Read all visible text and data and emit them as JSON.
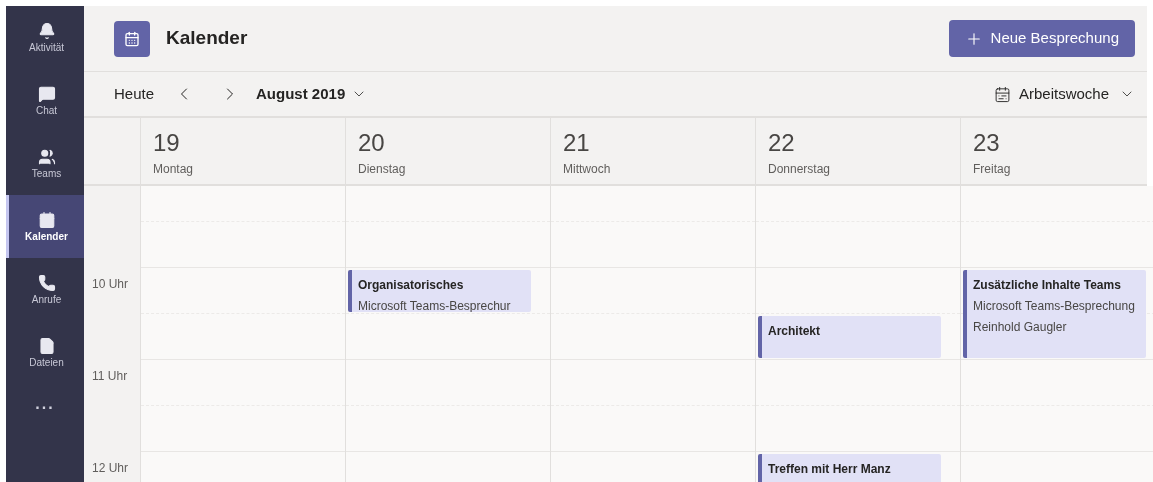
{
  "sidebar": {
    "items": [
      {
        "kind": "activity",
        "label": "Aktivität",
        "selected": false
      },
      {
        "kind": "chat",
        "label": "Chat",
        "selected": false
      },
      {
        "kind": "teams",
        "label": "Teams",
        "selected": false
      },
      {
        "kind": "calendar",
        "label": "Kalender",
        "selected": true
      },
      {
        "kind": "calls",
        "label": "Anrufe",
        "selected": false
      },
      {
        "kind": "files",
        "label": "Dateien",
        "selected": false
      }
    ],
    "more": "..."
  },
  "header": {
    "title": "Kalender",
    "new_meeting_button": "Neue Besprechung"
  },
  "toolbar": {
    "today": "Heute",
    "month": "August 2019",
    "view": "Arbeitswoche"
  },
  "days": [
    {
      "date": "19",
      "weekday": "Montag"
    },
    {
      "date": "20",
      "weekday": "Dienstag"
    },
    {
      "date": "21",
      "weekday": "Mittwoch"
    },
    {
      "date": "22",
      "weekday": "Donnerstag"
    },
    {
      "date": "23",
      "weekday": "Freitag"
    }
  ],
  "rows": [
    {
      "kind": "partial",
      "label": "",
      "cells": [
        null,
        null,
        null,
        null,
        null
      ]
    },
    {
      "kind": "half",
      "label": "",
      "cells": [
        null,
        null,
        null,
        null,
        null
      ]
    },
    {
      "kind": "hour",
      "label": "10 Uhr",
      "cells": [
        null,
        {
          "kind": "half_hour",
          "lines": [
            "Organisatorisches",
            "Microsoft Teams-Besprechur"
          ]
        },
        null,
        null,
        {
          "kind": "one_hour",
          "lines": [
            "Zusätzliche Inhalte Teams",
            "Microsoft Teams-Besprechung",
            "Reinhold Gaugler"
          ]
        }
      ]
    },
    {
      "kind": "half",
      "label": "",
      "cells": [
        null,
        null,
        null,
        {
          "kind": "half_hour",
          "lines": [
            "Architekt"
          ]
        },
        null
      ]
    },
    {
      "kind": "hour",
      "label": "11 Uhr",
      "cells": [
        null,
        null,
        null,
        null,
        null
      ]
    },
    {
      "kind": "half",
      "label": "",
      "cells": [
        null,
        null,
        null,
        null,
        null
      ]
    },
    {
      "kind": "hour",
      "label": "12 Uhr",
      "cells": [
        null,
        null,
        null,
        {
          "kind": "half_hour",
          "lines": [
            "Treffen mit Herr Manz"
          ]
        },
        null
      ]
    }
  ]
}
